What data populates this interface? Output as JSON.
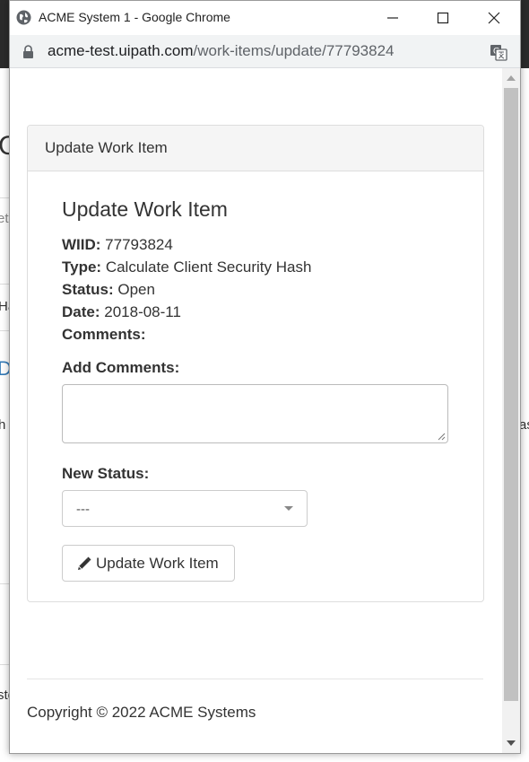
{
  "window": {
    "title": "ACME System 1 - Google Chrome",
    "url_host": "acme-test.uipath.com",
    "url_path": "/work-items/update/77793824"
  },
  "panel": {
    "heading": "Update Work Item",
    "form_title": "Update Work Item",
    "fields": [
      {
        "label": "WIID:",
        "value": "77793824"
      },
      {
        "label": "Type:",
        "value": "Calculate Client Security Hash"
      },
      {
        "label": "Status:",
        "value": "Open"
      },
      {
        "label": "Date:",
        "value": "2018-08-11"
      },
      {
        "label": "Comments:",
        "value": ""
      }
    ],
    "add_comments_label": "Add Comments:",
    "comments_value": "",
    "new_status_label": "New Status:",
    "new_status_selected": "---",
    "update_button_label": "Update Work Item"
  },
  "footer": {
    "copyright": "Copyright © 2022 ACME Systems"
  },
  "background": {
    "fragments": [
      "C",
      "et",
      "Ha",
      "D",
      "h",
      "as",
      "ste"
    ]
  },
  "icons": {
    "title": "globe-icon",
    "url": "lock-icon",
    "translate": "translate-icon",
    "button": "pencil-icon"
  }
}
